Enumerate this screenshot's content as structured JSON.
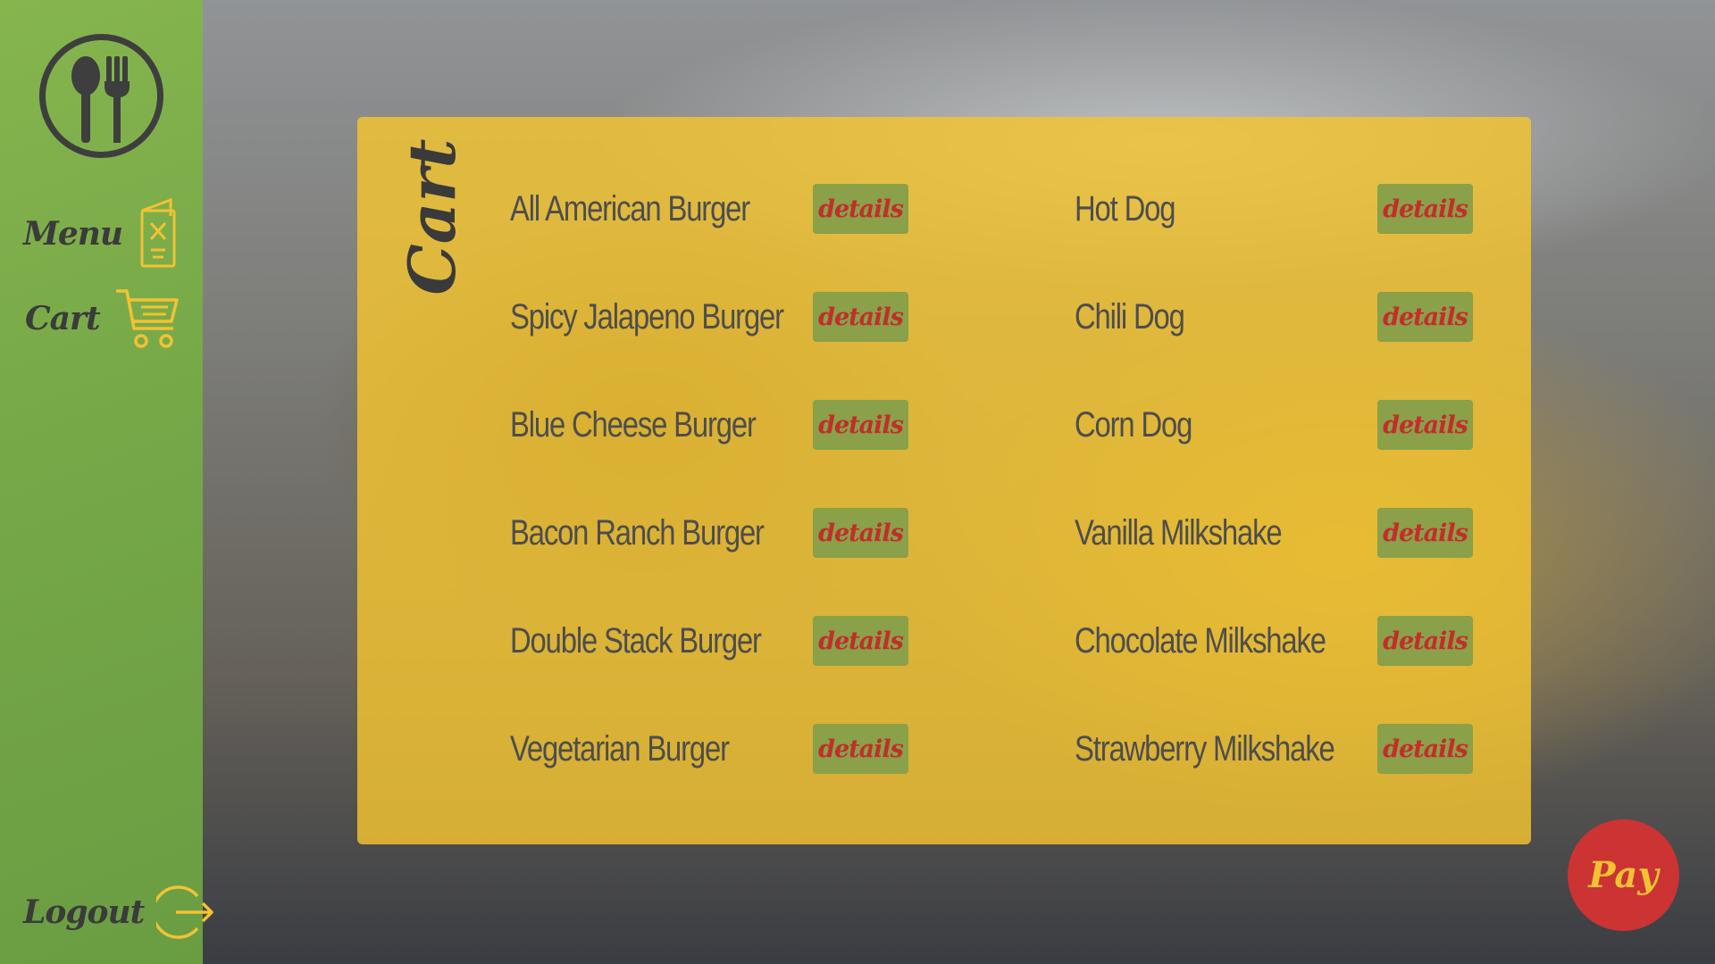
{
  "sidebar": {
    "logo_icon": "spoon-fork-icon",
    "menu_label": "Menu",
    "menu_icon": "menu-card-icon",
    "cart_label": "Cart",
    "cart_icon": "shopping-cart-icon",
    "logout_label": "Logout",
    "logout_icon": "logout-arrow-icon"
  },
  "cart": {
    "title": "Cart",
    "details_label": "details",
    "left_column": [
      {
        "name": "All American Burger"
      },
      {
        "name": "Spicy Jalapeno Burger"
      },
      {
        "name": "Blue Cheese Burger"
      },
      {
        "name": "Bacon Ranch Burger"
      },
      {
        "name": "Double Stack Burger"
      },
      {
        "name": "Vegetarian Burger"
      }
    ],
    "right_column": [
      {
        "name": "Hot Dog"
      },
      {
        "name": "Chili Dog"
      },
      {
        "name": "Corn Dog"
      },
      {
        "name": "Vanilla Milkshake"
      },
      {
        "name": "Chocolate Milkshake"
      },
      {
        "name": "Strawberry Milkshake"
      }
    ]
  },
  "pay": {
    "label": "Pay"
  },
  "colors": {
    "sidebar_green": "#76a848",
    "panel_yellow": "#f4c430",
    "details_green": "#8aa049",
    "details_text_red": "#c42d2a",
    "pay_red": "#cc3333",
    "pay_text_yellow": "#f2c233",
    "icon_yellow": "#f2c233",
    "dark_text": "#3b3b3b"
  }
}
